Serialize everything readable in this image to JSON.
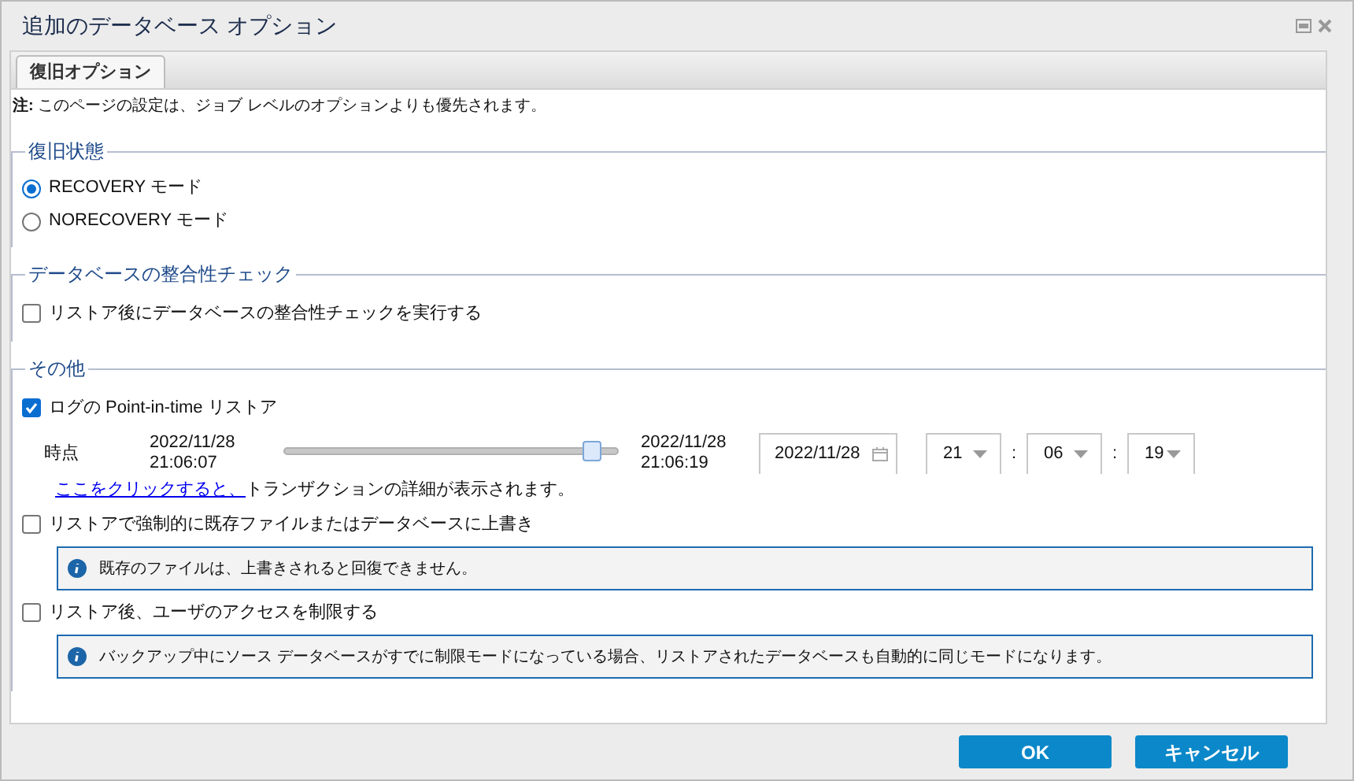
{
  "window": {
    "title": "追加のデータベース オプション"
  },
  "tabs": [
    {
      "label": "復旧オプション",
      "selected": true
    }
  ],
  "note": "**注:** このページの設定は、ジョブ レベルのオプションよりも優先されます。",
  "sections": [
    {
      "legend": "復旧状態",
      "items": [
        {
          "kind": "radio",
          "label": "RECOVERY モード",
          "selected": true
        },
        {
          "kind": "radio",
          "label": "NORECOVERY モード",
          "selected": false
        }
      ]
    },
    {
      "legend": "データベースの整合性チェック",
      "items": [
        {
          "kind": "checkbox",
          "label": "リストア後にデータベースの整合性チェックを実行する",
          "checked": false
        }
      ]
    },
    {
      "legend": "その他",
      "items": [
        {
          "kind": "checkbox",
          "label": "ログの Point-in-time リストア",
          "checked": true
        },
        {
          "kind": "point_in_time",
          "label": "時点",
          "start_date": "2022/11/28",
          "start_time": "21:06:07",
          "level": 0.92,
          "end_date": "2022/11/28",
          "end_time": "21:06:19",
          "date": "2022/11/28",
          "hour": "21",
          "minute": "06",
          "second": "19",
          "separators": [
            ":",
            ":"
          ]
        },
        {
          "kind": "link_text",
          "link": "ここをクリックすると、",
          "text": "トランザクションの詳細が表示されます。"
        },
        {
          "kind": "checkbox",
          "label": "リストアで強制的に既存ファイルまたはデータベースに上書き",
          "checked": false
        },
        {
          "kind": "info",
          "text": "既存のファイルは、上書きされると回復できません。"
        },
        {
          "kind": "checkbox",
          "label": "リストア後、ユーザのアクセスを制限する",
          "checked": false
        },
        {
          "kind": "info",
          "text": "バックアップ中にソース データベースがすでに制限モードになっている場合、リストアされたデータベースも自動的に同じモードになります。"
        }
      ]
    }
  ],
  "buttons": [
    {
      "label": "OK"
    },
    {
      "label": "キャンセル"
    }
  ]
}
